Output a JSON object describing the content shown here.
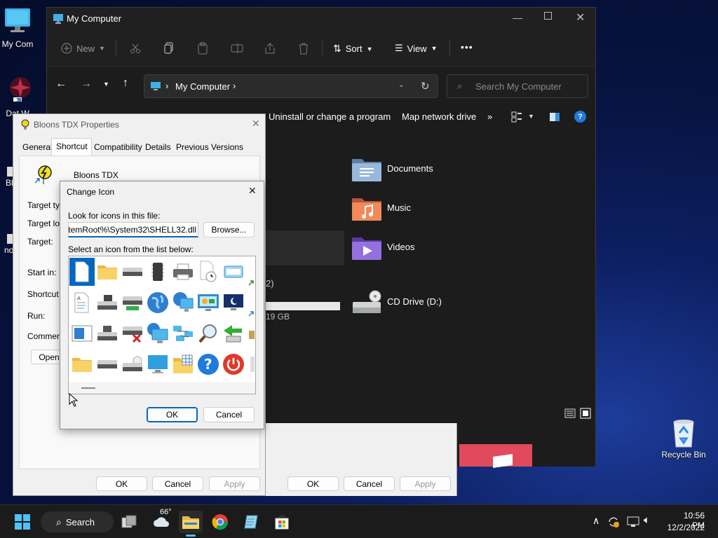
{
  "desktop": {
    "icons": [
      {
        "label": "My Com"
      },
      {
        "label": "Dat W"
      },
      {
        "label": "Bl"
      },
      {
        "label": "no"
      }
    ],
    "recycle_bin_label": "Recycle Bin"
  },
  "explorer": {
    "title": "My Computer",
    "toolbar": {
      "new_label": "New",
      "sort_label": "Sort",
      "view_label": "View",
      "more_label": "•••"
    },
    "address": {
      "location": "My Computer",
      "separator": "›"
    },
    "search": {
      "placeholder": "Search My Computer"
    },
    "commands": {
      "uninstall": "Uninstall or change a program",
      "map_drive": "Map network drive",
      "more": "»"
    },
    "items": [
      {
        "label": "Documents"
      },
      {
        "label": "Music"
      },
      {
        "label": "Videos"
      },
      {
        "label": "CD Drive (D:)"
      }
    ],
    "group_count_fragment": "2)",
    "disk_free_fragment": "19 GB",
    "disk_used_fraction": 1.0
  },
  "props_dialog": {
    "title": "Bloons TDX Properties",
    "tabs": [
      "General",
      "Shortcut",
      "Compatibility",
      "Details",
      "Previous Versions"
    ],
    "active_tab": "Shortcut",
    "app_name": "Bloons TDX",
    "labels": {
      "target_type": "Target typ",
      "target_loc": "Target loc",
      "target": "Target:",
      "start_in": "Start in:",
      "shortcut_key": "Shortcut k",
      "run": "Run:",
      "comment": "Comment:"
    },
    "open_btn": "Open",
    "ok": "OK",
    "cancel": "Cancel",
    "apply": "Apply"
  },
  "back_dialog_buttons": {
    "ok": "OK",
    "cancel": "Cancel",
    "apply": "Apply"
  },
  "change_icon": {
    "title": "Change Icon",
    "look_label": "Look for icons in this file:",
    "file_value": "%SystemRoot%\\System32\\SHELL32.dll",
    "browse": "Browse...",
    "list_label": "Select an icon from the list below:",
    "ok": "OK",
    "cancel": "Cancel",
    "icons": [
      [
        "blank-document-icon",
        "folder-icon",
        "drive-icon",
        "chip-icon",
        "printer-icon",
        "scheduled-document-icon",
        "network-window-icon"
      ],
      [
        "text-document-icon",
        "drive-floppy-icon",
        "network-drive-icon",
        "globe-icon",
        "network-computer-icon",
        "control-panel-icon",
        "sleep-monitor-icon"
      ],
      [
        "window-app-icon",
        "floppy-drive-icon",
        "disconnected-drive-icon",
        "networked-computer-icon",
        "network-connections-icon",
        "search-icon",
        "move-arrow-icon"
      ],
      [
        "closed-folder-icon",
        "removable-drive-icon",
        "cd-drive-icon",
        "monitor-icon",
        "folder-grid-icon",
        "help-icon",
        "power-icon"
      ]
    ]
  },
  "taskbar": {
    "search_label": "Search",
    "weather_temp": "66°",
    "time": "10:56 PM",
    "date": "12/2/2022"
  },
  "colors": {
    "accent": "#0067c0",
    "explorer_bg": "#1c1c1c",
    "selection": "#0067c0"
  }
}
